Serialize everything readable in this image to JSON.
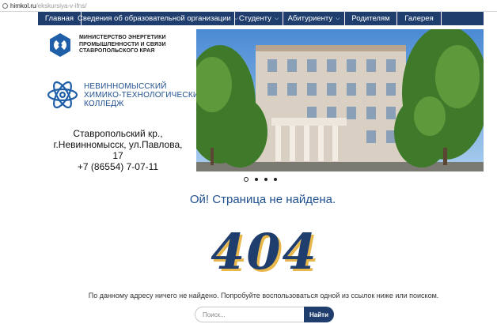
{
  "browser": {
    "host": "himkol.ru",
    "path": "/ekskursiya-v-ifns/"
  },
  "nav": {
    "items": [
      {
        "label": "Главная",
        "has_dropdown": false
      },
      {
        "label": "Сведения об образовательной организации",
        "has_dropdown": true
      },
      {
        "label": "Студенту",
        "has_dropdown": true
      },
      {
        "label": "Абитуриенту",
        "has_dropdown": true
      },
      {
        "label": "Родителям",
        "has_dropdown": false
      },
      {
        "label": "Галерея",
        "has_dropdown": false
      },
      {
        "label": "",
        "has_dropdown": false
      }
    ]
  },
  "logos": {
    "ministry": {
      "line1": "МИНИСТЕРСТВО ЭНЕРГЕТИКИ",
      "line2": "ПРОМЫШЛЕННОСТИ И СВЯЗИ",
      "line3": "СТАВРОПОЛЬСКОГО КРАЯ"
    },
    "college": {
      "line1": "НЕВИННОМЫССКИЙ",
      "line2": "ХИМИКО-ТЕХНОЛОГИЧЕСКИЙ",
      "line3": "КОЛЛЕДЖ"
    }
  },
  "address": {
    "line1": "Ставропольский кр.,",
    "line2": "г.Невинномысск, ул.Павлова, 17",
    "line3": "+7 (86554) 7-07-11"
  },
  "slider": {
    "count": 4,
    "active": 0
  },
  "error": {
    "title": "Ой! Страница не найдена.",
    "code": "404",
    "description": "По данному адресу ничего не найдено. Попробуйте воспользоваться одной из ссылок ниже или поиском."
  },
  "search": {
    "placeholder": "Поиск...",
    "button_label": "Найти"
  },
  "colors": {
    "nav_bg": "#1f3e6d",
    "accent": "#1f4f8f",
    "gold": "#e8b84d"
  }
}
